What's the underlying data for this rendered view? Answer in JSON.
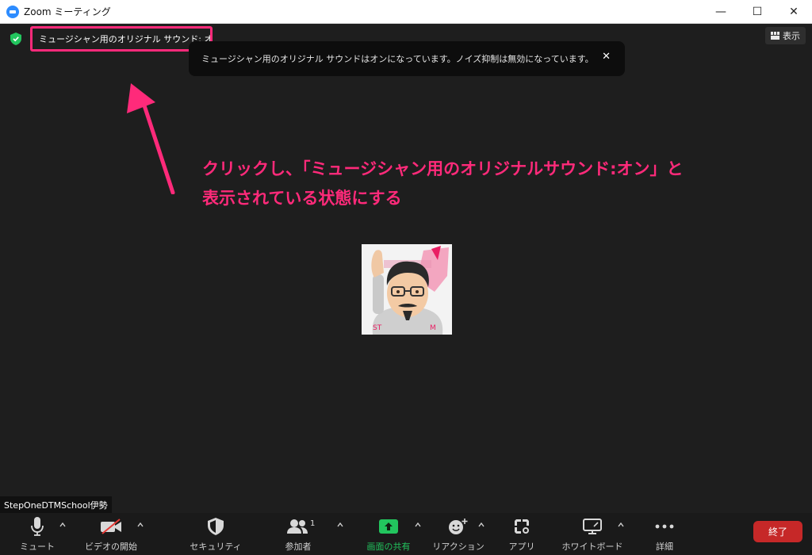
{
  "window": {
    "title": "Zoom ミーティング",
    "controls": {
      "minimize": "—",
      "maximize": "☐",
      "close": "✕"
    }
  },
  "meeting": {
    "music_mode_label": "ミュージシャン用のオリジナル サウンド: オン",
    "view_button_label": "表示",
    "notice_text": "ミュージシャン用のオリジナル サウンドはオンになっています。ノイズ抑制は無効になっています。",
    "notice_close": "✕",
    "participant_name": "StepOneDTMSchool伊勢"
  },
  "annotation": {
    "lines": [
      "クリックし、「ミュージシャン用のオリジナルサウンド:オン」と",
      "表示されている状態にする"
    ],
    "color": "#ff2a7a"
  },
  "toolbar": {
    "mute_label": "ミュート",
    "video_label": "ビデオの開始",
    "security_label": "セキュリティ",
    "participants_label": "参加者",
    "participants_count": "1",
    "share_label": "画面の共有",
    "reactions_label": "リアクション",
    "apps_label": "アプリ",
    "whiteboard_label": "ホワイトボード",
    "more_label": "詳細",
    "end_label": "終了"
  },
  "colors": {
    "background": "#1e1e1e",
    "accent_green": "#22c55e",
    "end_red": "#c62828",
    "zoom_blue": "#2d8cff"
  }
}
